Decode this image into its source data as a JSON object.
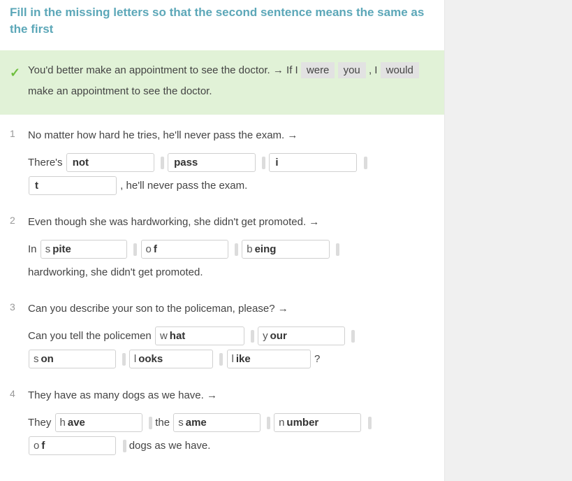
{
  "instruction": "Fill in the missing letters so that the second sentence means the same as the first",
  "example": {
    "part1": "You'd better make an appointment to see the doctor. → If I ",
    "ans1": "were",
    "mid1": "  ",
    "ans2": "you",
    "mid2": " , I ",
    "ans3": "would",
    "part2": " make an appointment to see the doctor."
  },
  "q1": {
    "num": "1",
    "prompt": "No matter how hard he tries, he'll never pass the exam. →",
    "line1_pre": "There's ",
    "b1_prefix": "",
    "b1_val": "not",
    "b2_prefix": "",
    "b2_val": "pass",
    "b3_prefix": "",
    "b3_val": "i",
    "b4_prefix": "",
    "b4_val": "t",
    "line2_post": " , he'll never pass the exam."
  },
  "q2": {
    "num": "2",
    "prompt": "Even though she was hardworking, she didn't get promoted. →",
    "line1_pre": "In ",
    "b1_prefix": "s",
    "b1_val": "pite",
    "b2_prefix": "o",
    "b2_val": "f",
    "b3_prefix": "b",
    "b3_val": "eing",
    "line2_post": "hardworking, she didn't get promoted."
  },
  "q3": {
    "num": "3",
    "prompt": "Can you describe your son to the policeman, please? →",
    "line1_pre": "Can you tell the policemen ",
    "b1_prefix": "w",
    "b1_val": "hat",
    "b2_prefix": "y",
    "b2_val": "our",
    "b3_prefix": "s",
    "b3_val": "on",
    "b4_prefix": "l",
    "b4_val": "ooks",
    "b5_prefix": "l",
    "b5_val": "ike",
    "line2_post": " ?"
  },
  "q4": {
    "num": "4",
    "prompt": "They have as many dogs as we have. →",
    "line1_pre": "They ",
    "b1_prefix": "h",
    "b1_val": "ave",
    "mid1": " the ",
    "b2_prefix": "s",
    "b2_val": "ame",
    "b3_prefix": "n",
    "b3_val": "umber",
    "b4_prefix": "o",
    "b4_val": "f",
    "line2_post": " dogs as we have."
  }
}
